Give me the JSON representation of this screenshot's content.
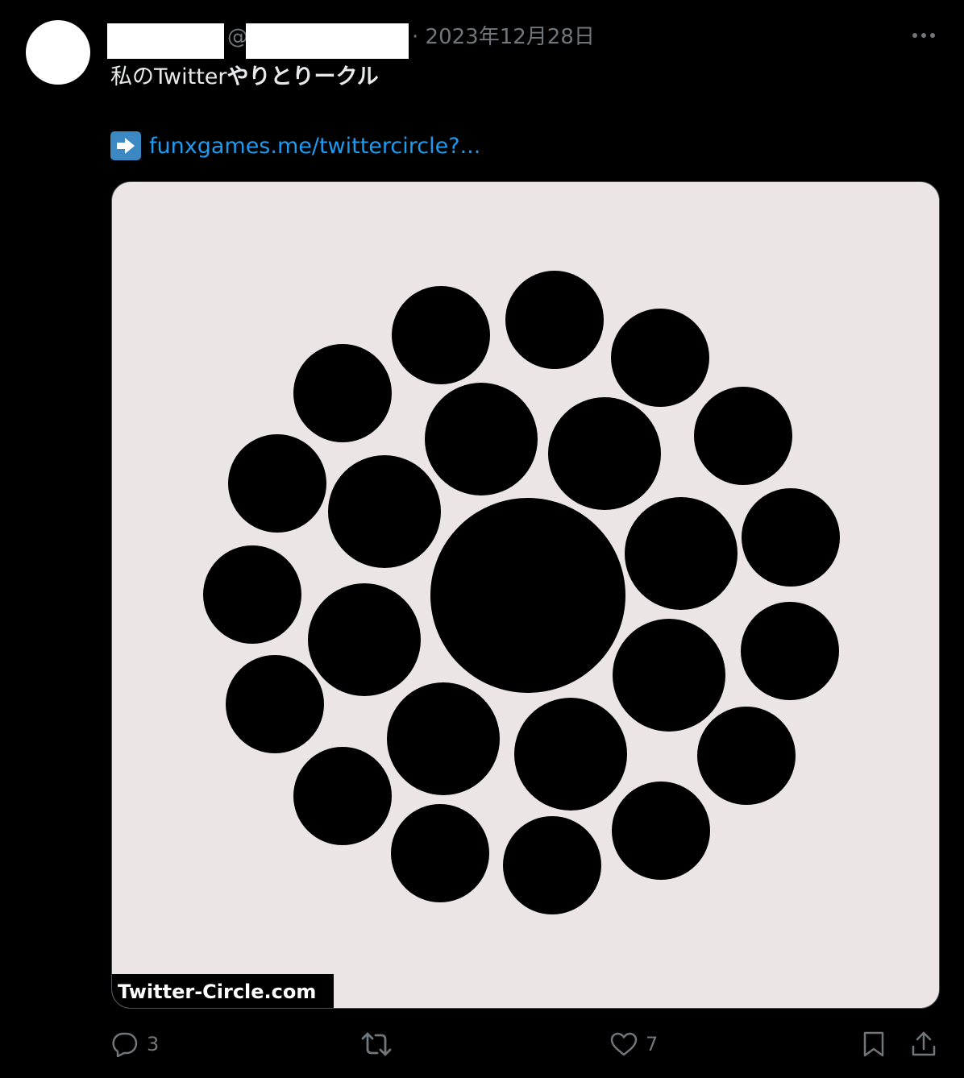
{
  "tweet": {
    "at_symbol": "@",
    "separator": "·",
    "date": "2023年12月28日",
    "text_normal": "私のTwitter",
    "text_bold": "やりとりークル",
    "link_text": "funxgames.me/twittercircle?..."
  },
  "image": {
    "watermark": "Twitter-Circle.com",
    "background_color": "#ebe5e6",
    "circle_color": "#000000"
  },
  "actions": {
    "reply_count": "3",
    "like_count": "7",
    "icons": [
      "reply-icon",
      "retweet-icon",
      "like-icon",
      "bookmark-icon",
      "share-icon"
    ]
  },
  "colors": {
    "background": "#000000",
    "text": "#e7e9ea",
    "secondary": "#71767b",
    "link": "#1d9bf0"
  }
}
